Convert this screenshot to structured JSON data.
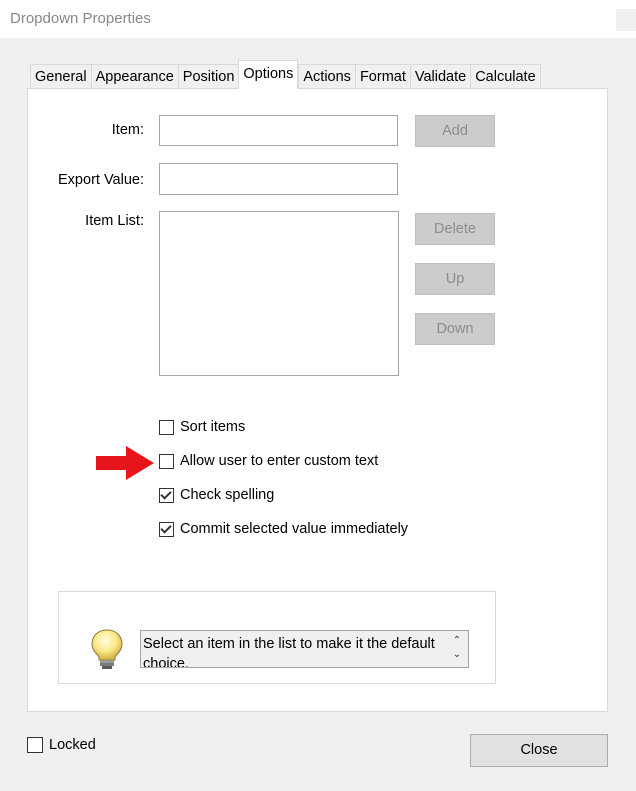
{
  "window": {
    "title": "Dropdown Properties"
  },
  "tabs": [
    {
      "label": "General",
      "active": false
    },
    {
      "label": "Appearance",
      "active": false
    },
    {
      "label": "Position",
      "active": false
    },
    {
      "label": "Options",
      "active": true
    },
    {
      "label": "Actions",
      "active": false
    },
    {
      "label": "Format",
      "active": false
    },
    {
      "label": "Validate",
      "active": false
    },
    {
      "label": "Calculate",
      "active": false
    }
  ],
  "options": {
    "item_label": "Item:",
    "item_value": "",
    "export_label": "Export Value:",
    "export_value": "",
    "list_label": "Item List:",
    "list_items": [],
    "add_button": "Add",
    "delete_button": "Delete",
    "up_button": "Up",
    "down_button": "Down",
    "checkboxes": [
      {
        "label": "Sort items",
        "checked": false
      },
      {
        "label": "Allow user to enter custom text",
        "checked": false
      },
      {
        "label": "Check spelling",
        "checked": true
      },
      {
        "label": "Commit selected value immediately",
        "checked": true
      }
    ]
  },
  "hint": {
    "text": "Select an item in the list to make it the default choice.",
    "icon": "lightbulb-icon"
  },
  "footer": {
    "locked_label": "Locked",
    "locked_checked": false,
    "close_button": "Close"
  },
  "colors": {
    "annotation_arrow": "#e8141c",
    "disabled_button": "#cccccc",
    "panel_bg": "#ffffff",
    "window_bg": "#f0f0f0"
  }
}
